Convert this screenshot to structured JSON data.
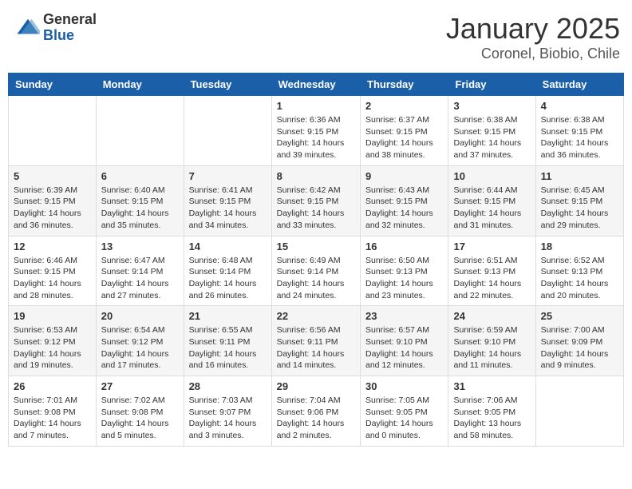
{
  "header": {
    "logo_general": "General",
    "logo_blue": "Blue",
    "month_title": "January 2025",
    "location": "Coronel, Biobio, Chile"
  },
  "weekdays": [
    "Sunday",
    "Monday",
    "Tuesday",
    "Wednesday",
    "Thursday",
    "Friday",
    "Saturday"
  ],
  "weeks": [
    [
      {
        "day": "",
        "sunrise": "",
        "sunset": "",
        "daylight": ""
      },
      {
        "day": "",
        "sunrise": "",
        "sunset": "",
        "daylight": ""
      },
      {
        "day": "",
        "sunrise": "",
        "sunset": "",
        "daylight": ""
      },
      {
        "day": "1",
        "sunrise": "Sunrise: 6:36 AM",
        "sunset": "Sunset: 9:15 PM",
        "daylight": "Daylight: 14 hours and 39 minutes."
      },
      {
        "day": "2",
        "sunrise": "Sunrise: 6:37 AM",
        "sunset": "Sunset: 9:15 PM",
        "daylight": "Daylight: 14 hours and 38 minutes."
      },
      {
        "day": "3",
        "sunrise": "Sunrise: 6:38 AM",
        "sunset": "Sunset: 9:15 PM",
        "daylight": "Daylight: 14 hours and 37 minutes."
      },
      {
        "day": "4",
        "sunrise": "Sunrise: 6:38 AM",
        "sunset": "Sunset: 9:15 PM",
        "daylight": "Daylight: 14 hours and 36 minutes."
      }
    ],
    [
      {
        "day": "5",
        "sunrise": "Sunrise: 6:39 AM",
        "sunset": "Sunset: 9:15 PM",
        "daylight": "Daylight: 14 hours and 36 minutes."
      },
      {
        "day": "6",
        "sunrise": "Sunrise: 6:40 AM",
        "sunset": "Sunset: 9:15 PM",
        "daylight": "Daylight: 14 hours and 35 minutes."
      },
      {
        "day": "7",
        "sunrise": "Sunrise: 6:41 AM",
        "sunset": "Sunset: 9:15 PM",
        "daylight": "Daylight: 14 hours and 34 minutes."
      },
      {
        "day": "8",
        "sunrise": "Sunrise: 6:42 AM",
        "sunset": "Sunset: 9:15 PM",
        "daylight": "Daylight: 14 hours and 33 minutes."
      },
      {
        "day": "9",
        "sunrise": "Sunrise: 6:43 AM",
        "sunset": "Sunset: 9:15 PM",
        "daylight": "Daylight: 14 hours and 32 minutes."
      },
      {
        "day": "10",
        "sunrise": "Sunrise: 6:44 AM",
        "sunset": "Sunset: 9:15 PM",
        "daylight": "Daylight: 14 hours and 31 minutes."
      },
      {
        "day": "11",
        "sunrise": "Sunrise: 6:45 AM",
        "sunset": "Sunset: 9:15 PM",
        "daylight": "Daylight: 14 hours and 29 minutes."
      }
    ],
    [
      {
        "day": "12",
        "sunrise": "Sunrise: 6:46 AM",
        "sunset": "Sunset: 9:15 PM",
        "daylight": "Daylight: 14 hours and 28 minutes."
      },
      {
        "day": "13",
        "sunrise": "Sunrise: 6:47 AM",
        "sunset": "Sunset: 9:14 PM",
        "daylight": "Daylight: 14 hours and 27 minutes."
      },
      {
        "day": "14",
        "sunrise": "Sunrise: 6:48 AM",
        "sunset": "Sunset: 9:14 PM",
        "daylight": "Daylight: 14 hours and 26 minutes."
      },
      {
        "day": "15",
        "sunrise": "Sunrise: 6:49 AM",
        "sunset": "Sunset: 9:14 PM",
        "daylight": "Daylight: 14 hours and 24 minutes."
      },
      {
        "day": "16",
        "sunrise": "Sunrise: 6:50 AM",
        "sunset": "Sunset: 9:13 PM",
        "daylight": "Daylight: 14 hours and 23 minutes."
      },
      {
        "day": "17",
        "sunrise": "Sunrise: 6:51 AM",
        "sunset": "Sunset: 9:13 PM",
        "daylight": "Daylight: 14 hours and 22 minutes."
      },
      {
        "day": "18",
        "sunrise": "Sunrise: 6:52 AM",
        "sunset": "Sunset: 9:13 PM",
        "daylight": "Daylight: 14 hours and 20 minutes."
      }
    ],
    [
      {
        "day": "19",
        "sunrise": "Sunrise: 6:53 AM",
        "sunset": "Sunset: 9:12 PM",
        "daylight": "Daylight: 14 hours and 19 minutes."
      },
      {
        "day": "20",
        "sunrise": "Sunrise: 6:54 AM",
        "sunset": "Sunset: 9:12 PM",
        "daylight": "Daylight: 14 hours and 17 minutes."
      },
      {
        "day": "21",
        "sunrise": "Sunrise: 6:55 AM",
        "sunset": "Sunset: 9:11 PM",
        "daylight": "Daylight: 14 hours and 16 minutes."
      },
      {
        "day": "22",
        "sunrise": "Sunrise: 6:56 AM",
        "sunset": "Sunset: 9:11 PM",
        "daylight": "Daylight: 14 hours and 14 minutes."
      },
      {
        "day": "23",
        "sunrise": "Sunrise: 6:57 AM",
        "sunset": "Sunset: 9:10 PM",
        "daylight": "Daylight: 14 hours and 12 minutes."
      },
      {
        "day": "24",
        "sunrise": "Sunrise: 6:59 AM",
        "sunset": "Sunset: 9:10 PM",
        "daylight": "Daylight: 14 hours and 11 minutes."
      },
      {
        "day": "25",
        "sunrise": "Sunrise: 7:00 AM",
        "sunset": "Sunset: 9:09 PM",
        "daylight": "Daylight: 14 hours and 9 minutes."
      }
    ],
    [
      {
        "day": "26",
        "sunrise": "Sunrise: 7:01 AM",
        "sunset": "Sunset: 9:08 PM",
        "daylight": "Daylight: 14 hours and 7 minutes."
      },
      {
        "day": "27",
        "sunrise": "Sunrise: 7:02 AM",
        "sunset": "Sunset: 9:08 PM",
        "daylight": "Daylight: 14 hours and 5 minutes."
      },
      {
        "day": "28",
        "sunrise": "Sunrise: 7:03 AM",
        "sunset": "Sunset: 9:07 PM",
        "daylight": "Daylight: 14 hours and 3 minutes."
      },
      {
        "day": "29",
        "sunrise": "Sunrise: 7:04 AM",
        "sunset": "Sunset: 9:06 PM",
        "daylight": "Daylight: 14 hours and 2 minutes."
      },
      {
        "day": "30",
        "sunrise": "Sunrise: 7:05 AM",
        "sunset": "Sunset: 9:05 PM",
        "daylight": "Daylight: 14 hours and 0 minutes."
      },
      {
        "day": "31",
        "sunrise": "Sunrise: 7:06 AM",
        "sunset": "Sunset: 9:05 PM",
        "daylight": "Daylight: 13 hours and 58 minutes."
      },
      {
        "day": "",
        "sunrise": "",
        "sunset": "",
        "daylight": ""
      }
    ]
  ]
}
